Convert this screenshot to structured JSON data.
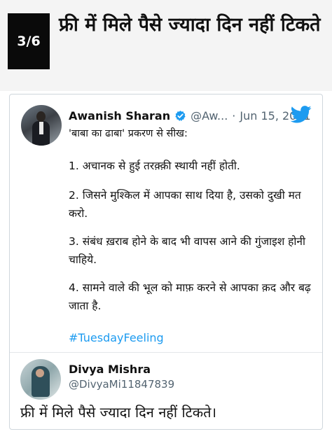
{
  "slide": {
    "counter": "3/6",
    "headline": "फ्री में मिले पैसे ज्यादा दिन नहीं टिकते"
  },
  "tweet": {
    "author_name": "Awanish Sharan",
    "handle": "@Aw...",
    "separator": "·",
    "date": "Jun 15, 2021",
    "lines": [
      "'बाबा का ढाबा' प्रकरण से सीख:",
      "1. अचानक से हुई तरक़्क़ी स्थायी नहीं होती.",
      "2. जिसने मुश्किल में आपका साथ दिया है, उसको दुखी मत करो.",
      "3. संबंध ख़राब होने के बाद भी वापस आने की गुंजाइश होनी चाहिये.",
      "4. सामने वाले की भूल को माफ़ करने से आपका क़द और बढ़ जाता है."
    ],
    "hashtag": "#TuesdayFeeling"
  },
  "reply": {
    "author_name": "Divya Mishra",
    "handle": "@DivyaMi11847839",
    "text": "फ्री में मिले पैसे ज्यादा दिन नहीं टिकते।"
  },
  "colors": {
    "accent": "#1d9bf0",
    "muted": "#536471",
    "counter_bg": "#0a0a0a",
    "header_bg": "#f4f4f4"
  },
  "icons": {
    "verified": "verified-badge-icon",
    "twitter": "twitter-bird-icon"
  }
}
